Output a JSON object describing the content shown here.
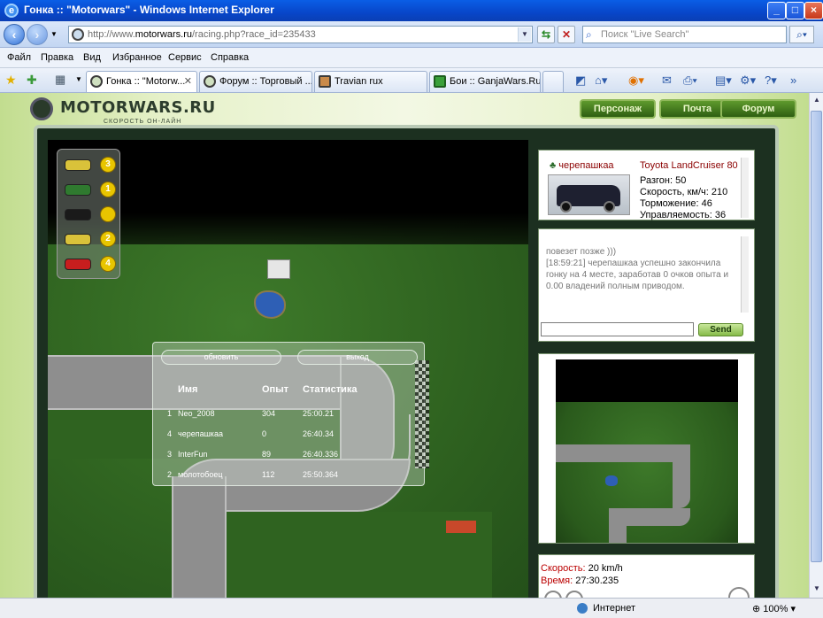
{
  "window": {
    "title": "Гонка :: \"Motorwars\" - Windows Internet Explorer",
    "minimize": "_",
    "maximize": "□",
    "close": "×"
  },
  "address": {
    "prefix": "http://www.",
    "domain": "motorwars.ru",
    "suffix": "/racing.php?race_id=235433",
    "search_placeholder": "Поиск \"Live Search\""
  },
  "menu": [
    "Файл",
    "Правка",
    "Вид",
    "Избранное",
    "Сервис",
    "Справка"
  ],
  "tabs": [
    {
      "label": "Гонка :: \"Motorw...",
      "active": true
    },
    {
      "label": "Форум :: Торговый ...",
      "active": false
    },
    {
      "label": "Travian rux",
      "active": false
    },
    {
      "label": "Бои :: GanjaWars.Ru...",
      "active": false
    }
  ],
  "site": {
    "logo_name": "MOTORWARS.RU",
    "slogan": "СКОРОСТЬ ОН-ЛАЙН",
    "nav": [
      "Персонаж",
      "Почта",
      "Форум"
    ]
  },
  "positions": [
    {
      "car_color": "#d9c23a",
      "place": "3"
    },
    {
      "car_color": "#2f7a2f",
      "place": "1"
    },
    {
      "car_color": "#1a1a1a",
      "place": ""
    },
    {
      "car_color": "#d9c23a",
      "place": "2"
    },
    {
      "car_color": "#c81e1e",
      "place": "4"
    }
  ],
  "results": {
    "refresh_label": "обновить",
    "exit_label": "выход",
    "headers": {
      "name": "Имя",
      "exp": "Опыт",
      "stat": "Статистика"
    },
    "rows": [
      {
        "place": "1",
        "name": "Neo_2008",
        "exp": "304",
        "time": "25:00.21"
      },
      {
        "place": "4",
        "name": "черепашкаа",
        "exp": "0",
        "time": "26:40.34"
      },
      {
        "place": "3",
        "name": "InterFun",
        "exp": "89",
        "time": "26:40.336"
      },
      {
        "place": "2",
        "name": "молотобоец",
        "exp": "112",
        "time": "25:50.364"
      }
    ]
  },
  "player": {
    "username": "черепашкаа",
    "car_model": "Toyota LandCruiser 80",
    "stats": [
      "Разгон: 50",
      "Скорость, км/ч: 210",
      "Торможение: 46",
      "Управляемость: 36"
    ]
  },
  "chat": {
    "message": "повезет позже )))\n[18:59:21] черепашкаа успешно закончила гонку на 4 месте, заработав 0 очков опыта и 0.00 владений полным приводом.",
    "send_label": "Send",
    "input_value": ""
  },
  "race_info": {
    "speed_label": "Скорость:",
    "speed_value": "20 km/h",
    "time_label": "Время:",
    "time_value": "27:30.235"
  },
  "status": {
    "zone": "Интернет",
    "zoom": "100%"
  },
  "colors": {
    "button_green": "#2e5f12",
    "label_red": "#b00000",
    "ie_blue": "#0846c9"
  }
}
